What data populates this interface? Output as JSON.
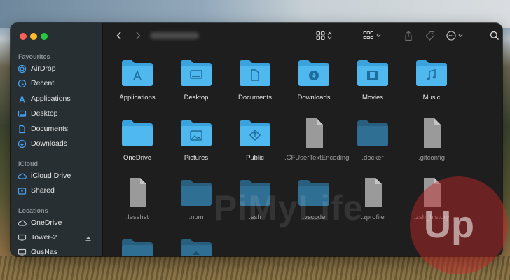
{
  "sidebar": {
    "sections": [
      {
        "title": "Favourites",
        "items": [
          {
            "label": "AirDrop",
            "icon": "airdrop-icon"
          },
          {
            "label": "Recent",
            "icon": "clock-icon"
          },
          {
            "label": "Applications",
            "icon": "applications-icon"
          },
          {
            "label": "Desktop",
            "icon": "desktop-icon"
          },
          {
            "label": "Documents",
            "icon": "document-icon"
          },
          {
            "label": "Downloads",
            "icon": "download-icon"
          }
        ]
      },
      {
        "title": "iCloud",
        "items": [
          {
            "label": "iCloud Drive",
            "icon": "cloud-icon"
          },
          {
            "label": "Shared",
            "icon": "shared-folder-icon"
          }
        ]
      },
      {
        "title": "Locations",
        "items": [
          {
            "label": "OneDrive",
            "icon": "cloud-icon"
          },
          {
            "label": "Tower-2",
            "icon": "display-icon"
          },
          {
            "label": "GusNas",
            "icon": "display-icon"
          }
        ]
      }
    ]
  },
  "toolbar": {
    "back": "back-chevron-icon",
    "forward": "forward-chevron-icon",
    "view": "icon-grid-view-icon",
    "group": "group-by-icon",
    "share": "share-icon",
    "tag": "tag-icon",
    "more": "ellipsis-icon",
    "search": "search-icon"
  },
  "files": [
    {
      "name": "Applications",
      "kind": "folder",
      "glyph": "A"
    },
    {
      "name": "Desktop",
      "kind": "folder",
      "glyph": "desktop"
    },
    {
      "name": "Documents",
      "kind": "folder",
      "glyph": "doc"
    },
    {
      "name": "Downloads",
      "kind": "folder",
      "glyph": "download"
    },
    {
      "name": "Movies",
      "kind": "folder",
      "glyph": "film"
    },
    {
      "name": "Music",
      "kind": "folder",
      "glyph": "note"
    },
    {
      "name": "OneDrive",
      "kind": "folder",
      "glyph": ""
    },
    {
      "name": "Pictures",
      "kind": "folder",
      "glyph": "picture"
    },
    {
      "name": "Public",
      "kind": "folder",
      "glyph": "public"
    },
    {
      "name": ".CFUserTextEncoding",
      "kind": "file"
    },
    {
      "name": ".docker",
      "kind": "hidden-folder"
    },
    {
      "name": ".gitconfig",
      "kind": "file"
    },
    {
      "name": ".lesshst",
      "kind": "file"
    },
    {
      "name": ".npm",
      "kind": "hidden-folder"
    },
    {
      "name": ".ssh",
      "kind": "hidden-folder"
    },
    {
      "name": ".vscode",
      "kind": "hidden-folder"
    },
    {
      "name": ".zprofile",
      "kind": "file"
    },
    {
      "name": ".zsh_history",
      "kind": "file"
    },
    {
      "name": "",
      "kind": "hidden-folder"
    },
    {
      "name": "",
      "kind": "hidden-folder-public"
    }
  ],
  "watermark": {
    "text": "PiMyLife",
    "badge": "Up"
  },
  "colors": {
    "folder": "#4fb8ee",
    "folder_tab": "#3aa2dc",
    "hidden_folder": "#2f6f93",
    "file": "#9a9a9a",
    "accent": "#3b9cf0"
  }
}
